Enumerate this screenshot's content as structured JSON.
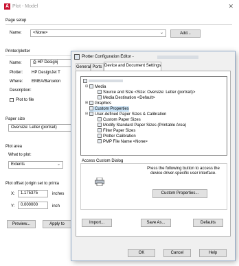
{
  "plot_dialog": {
    "title": "Plot - Model",
    "page_setup": {
      "heading": "Page setup",
      "name_label": "Name:",
      "name_value": "<None>",
      "add_button": "Add..."
    },
    "printer": {
      "heading": "Printer/plotter",
      "name_label": "Name:",
      "name_value": "HP Designj",
      "plotter_label": "Plotter:",
      "plotter_value": "HP DesignJet T",
      "where_label": "Where:",
      "where_value": "EMEA/Barcelon",
      "description_label": "Description:",
      "plot_to_file": "Plot to file"
    },
    "paper_size": {
      "heading": "Paper size",
      "value": "Oversize: Letter (portrait)"
    },
    "plot_area": {
      "heading": "Plot area",
      "what_label": "What to plot:",
      "what_value": "Extents"
    },
    "plot_offset": {
      "heading": "Plot offset (origin set to printa",
      "x_label": "X:",
      "x_value": "1.175375",
      "x_unit": "inches",
      "y_label": "Y:",
      "y_value": "0.000000",
      "y_unit": "inch"
    },
    "preview_button": "Preview...",
    "apply_button": "Apply to"
  },
  "config_editor": {
    "title": "Plotter Configuration Editor -",
    "tabs": [
      "General",
      "Ports",
      "Device and Document Settings"
    ],
    "tree": {
      "root": "",
      "media": "Media",
      "source_and_size": "Source and Size <Size: Oversize: Letter (portrait)>",
      "media_destination": "Media Destination <Default>",
      "graphics": "Graphics",
      "custom_properties": "Custom Properties",
      "user_paper": "User-defined Paper Sizes & Calibration",
      "custom_paper_sizes": "Custom Paper Sizes",
      "modify_standard": "Modify Standard Paper Sizes (Printable Area)",
      "filter_paper": "Filter Paper Sizes",
      "plotter_calibration": "Plotter Calibration",
      "pmp_file": "PMP File Name <None>"
    },
    "access": {
      "heading": "Access Custom Dialog",
      "description": "Press the following button to access the device driver-specific user interface.",
      "button": "Custom Properties..."
    },
    "import_button": "Import...",
    "save_as_button": "Save As...",
    "defaults_button": "Defaults",
    "ok_button": "OK",
    "cancel_button": "Cancel",
    "help_button": "Help"
  }
}
